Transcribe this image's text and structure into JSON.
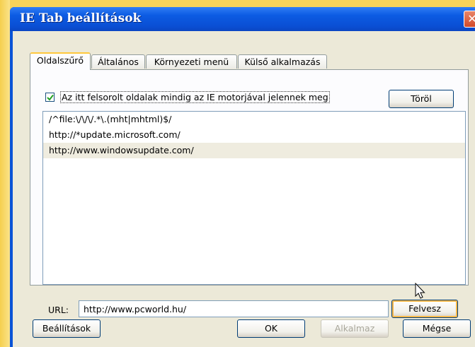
{
  "window": {
    "title": "IE Tab beállítások"
  },
  "tabs": [
    {
      "label": "Oldalszűrő",
      "active": true
    },
    {
      "label": "Általános",
      "active": false
    },
    {
      "label": "Környezeti menü",
      "active": false
    },
    {
      "label": "Külső alkalmazás",
      "active": false
    }
  ],
  "filter": {
    "checkbox_checked": true,
    "checkbox_label": "Az itt felsorolt oldalak mindig az IE motorjával jelennek meg",
    "delete_label": "Töröl",
    "items": [
      "/^file:\\/\\/\\/.*\\.(mht|mhtml)$/",
      "http://*update.microsoft.com/",
      "http://www.windowsupdate.com/"
    ],
    "selected_index": 2,
    "url_label": "URL:",
    "url_value": "http://www.pcworld.hu/",
    "add_label": "Felvesz"
  },
  "footer": {
    "settings_label": "Beállítások",
    "ok_label": "OK",
    "apply_label": "Alkalmaz",
    "cancel_label": "Mégse"
  },
  "icons": {
    "close": "close-icon",
    "check": "check-icon",
    "cursor": "mouse-pointer-icon"
  },
  "colors": {
    "titlebar": "#0a53d6",
    "check": "#21a121",
    "focus": "#f9b84a",
    "dialog": "#ece9d8"
  }
}
